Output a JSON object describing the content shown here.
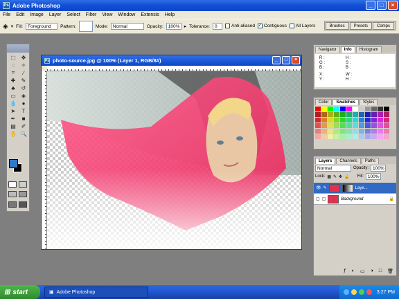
{
  "window": {
    "title": "Adobe Photoshop"
  },
  "menu": [
    "File",
    "Edit",
    "Image",
    "Layer",
    "Select",
    "Filter",
    "View",
    "Window",
    "Extensis",
    "Help"
  ],
  "options": {
    "fill_label": "Fill:",
    "fill_value": "Foreground",
    "pattern_label": "Pattern:",
    "mode_label": "Mode:",
    "mode_value": "Normal",
    "opacity_label": "Opacity:",
    "opacity_value": "100%",
    "tolerance_label": "Tolerance:",
    "tolerance_value": "0",
    "antialiased": "Anti-aliased",
    "contiguous": "Contiguous",
    "all_layers": "All Layers"
  },
  "palette_well": [
    "Brushes",
    "Presets",
    "Comps"
  ],
  "document": {
    "title": "photo-source.jpg @ 100% (Layer 1, RGB/8#)"
  },
  "navigator_panel": {
    "tabs": [
      "Navigator",
      "Info",
      "Histogram"
    ],
    "info_labels_left": [
      "R :",
      "G :",
      "B :"
    ],
    "info_labels_right": [
      "H :",
      "S :",
      "B :"
    ],
    "info_labels_left2": [
      "X :",
      "Y :"
    ],
    "info_labels_right2": [
      "W :",
      "H :"
    ]
  },
  "swatches_panel": {
    "tabs": [
      "Color",
      "Swatches",
      "Styles"
    ]
  },
  "layers_panel": {
    "tabs": [
      "Layers",
      "Channels",
      "Paths"
    ],
    "blend": "Normal",
    "opacity_label": "Opacity:",
    "opacity": "100%",
    "lock_label": "Lock:",
    "fill_label": "Fill:",
    "fill": "100%",
    "layers": [
      {
        "name": "Laye..."
      },
      {
        "name": "Background"
      }
    ]
  },
  "taskbar": {
    "start": "start",
    "task": "Adobe Photoshop",
    "clock": "3:27 PM"
  }
}
